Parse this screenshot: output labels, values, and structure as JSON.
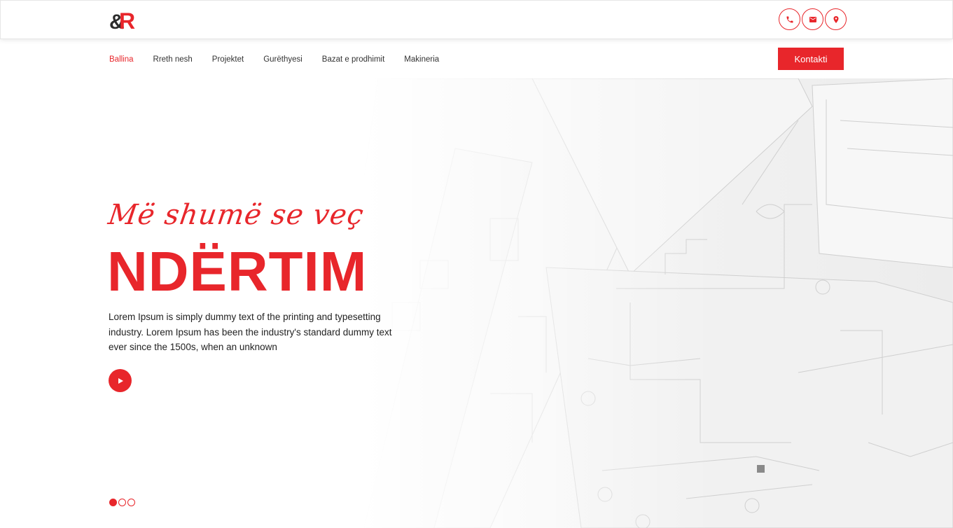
{
  "header": {
    "logo_text": "&R",
    "contact_icons": [
      {
        "name": "phone-icon"
      },
      {
        "name": "mail-icon"
      },
      {
        "name": "location-icon"
      }
    ]
  },
  "nav": {
    "items": [
      {
        "label": "Ballina",
        "active": true
      },
      {
        "label": "Rreth nesh",
        "active": false
      },
      {
        "label": "Projektet",
        "active": false
      },
      {
        "label": "Gurëthyesi",
        "active": false
      },
      {
        "label": "Bazat e prodhimit",
        "active": false
      },
      {
        "label": "Makineria",
        "active": false
      }
    ],
    "cta_label": "Kontakti"
  },
  "hero": {
    "script_title": "Më shumë se veç",
    "main_title": "NDËRTIM",
    "text": "Lorem Ipsum is simply dummy text of the printing and typesetting industry. Lorem Ipsum has been the industry's standard dummy text ever since the 1500s, when an unknown",
    "slides_count": 3,
    "active_slide": 1
  },
  "colors": {
    "accent": "#e8262b",
    "text": "#222222",
    "background": "#ffffff"
  }
}
